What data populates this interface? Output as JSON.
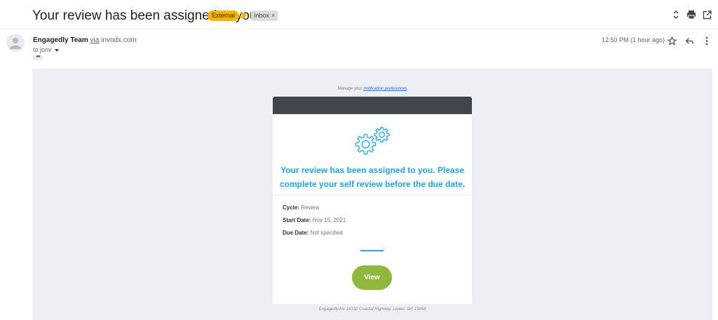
{
  "subject": "Your review has been assigned to you.",
  "labels": {
    "external": "External",
    "inbox": "Inbox",
    "remove_symbol": "×"
  },
  "sender": {
    "name": "Engagedly Team",
    "via": "via",
    "domain": "invodx.com",
    "to_line": "to jonv",
    "expand_dots": "•••"
  },
  "time": "12:50 PM (1 hour ago)",
  "icons": {
    "toolbar": [
      "up-down-arrows-icon",
      "print-icon",
      "open-in-new-window-icon"
    ],
    "header": [
      "star-icon",
      "reply-icon",
      "more-vert-icon"
    ],
    "importance": "importance-marker-icon",
    "illustration": "gears-icon"
  },
  "email": {
    "manage_prefix": "Manage your",
    "manage_link": "notification preferences",
    "headline_line1": "Your review has been assigned to you. Please",
    "headline_line2": "complete your self review before the due date.",
    "fields": [
      {
        "key": "Cycle:",
        "value": "Review"
      },
      {
        "key": "Start Date:",
        "value": "Nov 15, 2021"
      },
      {
        "key": "Due Date:",
        "value": "Not specified"
      }
    ],
    "button": "View",
    "footer": "Engagedly.Inc 16192 Coastal Highway, Lewes, DE 19958"
  },
  "colors": {
    "external_label": "#f5b400",
    "importance": "#f5b400",
    "card_header": "#40464b",
    "headline": "#1ea6e0",
    "button": "#8fb83d",
    "body_background": "#eceff3"
  }
}
